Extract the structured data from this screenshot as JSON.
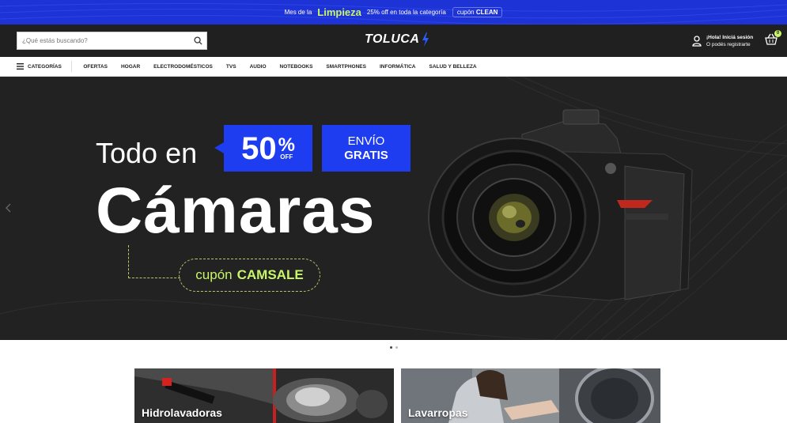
{
  "promo": {
    "prefix": "Mes de la",
    "highlight": "Limpieza",
    "text": "25% off en toda la categoría",
    "coupon_label": "cupón",
    "coupon_code": "CLEAN"
  },
  "header": {
    "search_placeholder": "¿Qué estás buscando?",
    "logo": "TOLUCA",
    "account_line1": "¡Hola! Iniciá sesión",
    "account_line2": "O podés registrarte",
    "cart_count": "0"
  },
  "nav": {
    "categories_label": "CATEGORÍAS",
    "items": [
      "OFERTAS",
      "HOGAR",
      "ELECTRODOMÉSTICOS",
      "TVS",
      "AUDIO",
      "NOTEBOOKS",
      "SMARTPHONES",
      "INFORMÁTICA",
      "SALUD Y BELLEZA"
    ]
  },
  "hero": {
    "line1": "Todo en",
    "discount_number": "50",
    "discount_symbol": "%",
    "discount_off": "OFF",
    "shipping_line1": "ENVÍO",
    "shipping_line2": "GRATIS",
    "headline": "Cámaras",
    "coupon_label": "cupón",
    "coupon_code": "CAMSALE"
  },
  "carousel": {
    "slides": 2,
    "active": 1
  },
  "categories": [
    {
      "label": "Hidrolavadoras"
    },
    {
      "label": "Lavarropas"
    }
  ],
  "colors": {
    "promo_bg": "#1e33d6",
    "header_bg": "#202020",
    "accent_blue": "#1e3cf0",
    "accent_lime": "#c8f569",
    "hero_bg": "#222222"
  }
}
